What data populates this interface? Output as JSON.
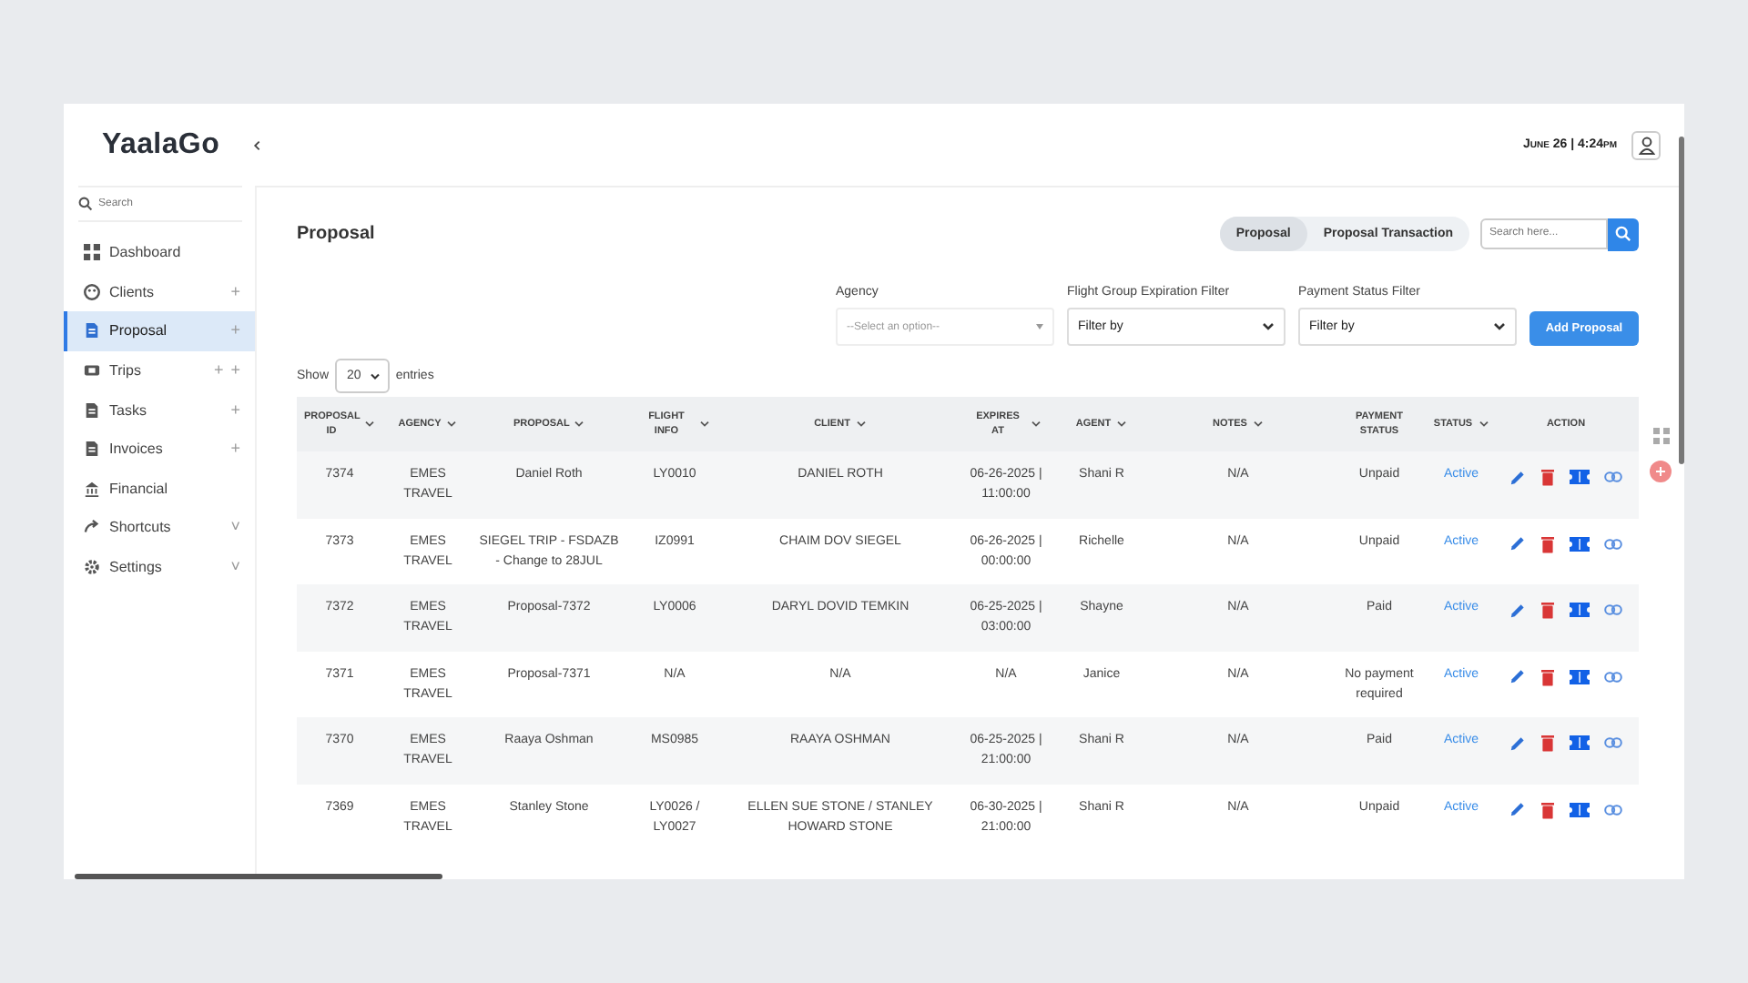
{
  "brand": "YaalaGo",
  "sidebar": {
    "search_placeholder": "Search",
    "items": [
      {
        "label": "Dashboard",
        "selected": false
      },
      {
        "label": "Clients",
        "selected": false,
        "trailing": [
          "+"
        ]
      },
      {
        "label": "Proposal",
        "selected": true,
        "trailing": [
          "+"
        ]
      },
      {
        "label": "Trips",
        "selected": false,
        "trailing": [
          "+",
          "+"
        ]
      },
      {
        "label": "Tasks",
        "selected": false,
        "trailing": [
          "+"
        ]
      },
      {
        "label": "Invoices",
        "selected": false,
        "trailing": [
          "+"
        ]
      },
      {
        "label": "Financial",
        "selected": false
      },
      {
        "label": "Shortcuts",
        "selected": false,
        "trailing": [
          "˅"
        ]
      },
      {
        "label": "Settings",
        "selected": false,
        "trailing": [
          "˅"
        ]
      }
    ]
  },
  "header": {
    "datetime": "June 26 | 4:24pm"
  },
  "page_title": "Proposal",
  "tabs": [
    {
      "label": "Proposal",
      "selected": true
    },
    {
      "label": "Proposal Transaction",
      "selected": false
    }
  ],
  "search": {
    "placeholder": "Search here..."
  },
  "filters": [
    {
      "label": "Agency",
      "value": "--Select an option--",
      "kind": "combo"
    },
    {
      "label": "Flight Group Expiration Filter",
      "value": "Filter by",
      "kind": "select"
    },
    {
      "label": "Payment Status Filter",
      "value": "Filter by",
      "kind": "select"
    }
  ],
  "add_button": "Add Proposal",
  "show_entries": {
    "before": "Show",
    "value": "20",
    "after": "entries"
  },
  "table": {
    "columns": [
      {
        "label": "PROPOSAL ID",
        "sortable": true
      },
      {
        "label": "AGENCY",
        "sortable": true
      },
      {
        "label": "PROPOSAL",
        "sortable": true
      },
      {
        "label": "FLIGHT INFO",
        "sortable": true
      },
      {
        "label": "CLIENT",
        "sortable": true
      },
      {
        "label": "EXPIRES AT",
        "sortable": true
      },
      {
        "label": "AGENT",
        "sortable": true
      },
      {
        "label": "NOTES",
        "sortable": true
      },
      {
        "label": "PAYMENT STATUS",
        "sortable": false
      },
      {
        "label": "STATUS",
        "sortable": true
      },
      {
        "label": "ACTION",
        "sortable": false
      }
    ],
    "rows": [
      {
        "cells": [
          "7374",
          "EMES TRAVEL",
          "Daniel Roth",
          "LY0010",
          "DANIEL ROTH",
          "06-26-2025 | 11:00:00",
          "Shani R",
          "N/A",
          "Unpaid",
          "Active"
        ]
      },
      {
        "cells": [
          "7373",
          "EMES TRAVEL",
          "SIEGEL TRIP - FSDAZB - Change to 28JUL",
          "IZ0991",
          "CHAIM DOV SIEGEL",
          "06-26-2025 | 00:00:00",
          "Richelle",
          "N/A",
          "Unpaid",
          "Active"
        ]
      },
      {
        "cells": [
          "7372",
          "EMES TRAVEL",
          "Proposal-7372",
          "LY0006",
          "DARYL DOVID TEMKIN",
          "06-25-2025 | 03:00:00",
          "Shayne",
          "N/A",
          "Paid",
          "Active"
        ]
      },
      {
        "cells": [
          "7371",
          "EMES TRAVEL",
          "Proposal-7371",
          "N/A",
          "N/A",
          "N/A",
          "Janice",
          "N/A",
          "No payment required",
          "Active"
        ]
      },
      {
        "cells": [
          "7370",
          "EMES TRAVEL",
          "Raaya Oshman",
          "MS0985",
          "RAAYA OSHMAN",
          "06-25-2025 | 21:00:00",
          "Shani R",
          "N/A",
          "Paid",
          "Active"
        ]
      },
      {
        "cells": [
          "7369",
          "EMES TRAVEL",
          "Stanley Stone",
          "LY0026 / LY0027",
          "ELLEN SUE STONE / STANLEY HOWARD STONE",
          "06-30-2025 | 21:00:00",
          "Shani R",
          "N/A",
          "Unpaid",
          "Active"
        ]
      }
    ]
  }
}
